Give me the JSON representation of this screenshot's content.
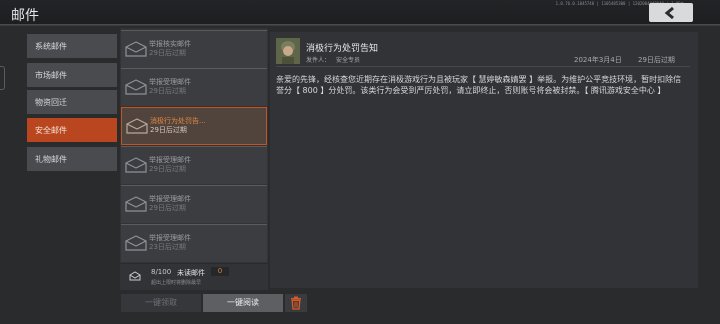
{
  "window": {
    "title": "邮件",
    "version": "1.0.76.0.1045748 | 1105485300 | 1202004440048 | 1 版本"
  },
  "categories": [
    {
      "label": "系统邮件",
      "active": false
    },
    {
      "label": "市场邮件",
      "active": false
    },
    {
      "label": "物资回迁",
      "active": false
    },
    {
      "label": "安全邮件",
      "active": true
    },
    {
      "label": "礼物邮件",
      "active": false
    }
  ],
  "mails": [
    {
      "title": "举报核实邮件",
      "expire": "29日后过期",
      "selected": false
    },
    {
      "title": "举报受理邮件",
      "expire": "29日后过期",
      "selected": false
    },
    {
      "title": "消极行为处罚告...",
      "expire": "29日后过期",
      "selected": true
    },
    {
      "title": "举报受理邮件",
      "expire": "29日后过期",
      "selected": false
    },
    {
      "title": "举报受理邮件",
      "expire": "29日后过期",
      "selected": false
    },
    {
      "title": "举报受理邮件",
      "expire": "23日后过期",
      "selected": false
    }
  ],
  "footer": {
    "count": "8/100",
    "unread_label": "未读邮件",
    "unread_count": "0",
    "note": "超出上限时将删除最早"
  },
  "buttons": {
    "claim_all": "一键领取",
    "read_all": "一键阅读"
  },
  "detail": {
    "title": "消极行为处罚告知",
    "sender_label": "发件人：",
    "sender": "安全专员",
    "date": "2024年3月4日",
    "expire": "29日后过期",
    "body": "亲爱的先锋，经核查您近期存在消极游戏行为且被玩家【 慧婷敏森婧罢 】举报。为维护公平竞技环境，暂时扣除信誉分【 800 】分处罚。该类行为会受到严厉处罚，请立即终止，否则账号将会被封禁。【 腾讯游戏安全中心 】"
  },
  "colors": {
    "accent": "#b9461f",
    "selected_text": "#e5873f",
    "delete_icon": "#d95a27"
  },
  "icons": {
    "back": "back-arrow-icon",
    "envelope": "envelope-open-icon",
    "mailbox": "mailbox-icon",
    "trash": "trash-icon"
  }
}
